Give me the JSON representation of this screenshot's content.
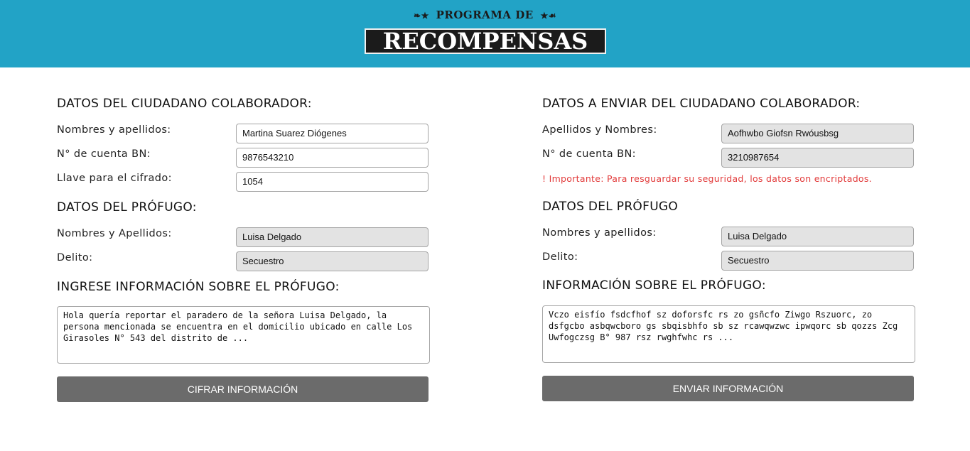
{
  "header": {
    "logo_top": "PROGRAMA DE",
    "logo_main": "RECOMPENSAS",
    "ornament_left": "❧★",
    "ornament_right": "★☙"
  },
  "left": {
    "collaborator_title": "DATOS DEL CIUDADANO COLABORADOR:",
    "name_label": "Nombres y apellidos:",
    "name_value": "Martina Suarez Diógenes",
    "account_label": "N° de cuenta BN:",
    "account_value": "9876543210",
    "key_label": "Llave para el cifrado:",
    "key_value": "1054",
    "fugitive_title": "DATOS DEL PRÓFUGO:",
    "fugitive_name_label": "Nombres y Apellidos:",
    "fugitive_name_value": "Luisa Delgado",
    "crime_label": "Delito:",
    "crime_value": "Secuestro",
    "info_title": "INGRESE INFORMACIÓN SOBRE EL PRÓFUGO:",
    "info_text": "Hola quería reportar el paradero de la señora Luisa Delgado, la persona mencionada se encuentra en el domicilio ubicado en calle Los Girasoles N° 543 del distrito de ...",
    "button_label": "CIFRAR INFORMACIÓN"
  },
  "right": {
    "collaborator_title": "DATOS A ENVIAR DEL CIUDADANO COLABORADOR:",
    "name_label": "Apellidos y Nombres:",
    "name_value": "Aofhwbo Giofsn Rwóusbsg",
    "account_label": "N° de cuenta BN:",
    "account_value": "3210987654",
    "warning": "! Importante: Para resguardar su seguridad, los datos son encriptados.",
    "fugitive_title": "DATOS DEL PRÓFUGO",
    "fugitive_name_label": "Nombres y apellidos:",
    "fugitive_name_value": "Luisa Delgado",
    "crime_label": "Delito:",
    "crime_value": "Secuestro",
    "info_title": "INFORMACIÓN SOBRE EL PRÓFUGO:",
    "info_text": "Vczo eisfío fsdcfhof sz doforsfc rs zo gsñcfo Ziwgo Rszuorc, zo dsfgcbo asbqwcboro gs sbqisbhfo sb sz rcawqwzwc ipwqorc sb qozzs Zcg Uwfogczsg B° 987 rsz rwghfwhc rs ...",
    "button_label": "ENVIAR INFORMACIÓN"
  },
  "colors": {
    "header_bg": "#22a3c6",
    "button_bg": "#6b6b6b",
    "warning": "#e23b3b",
    "disabled_bg": "#e3e3e3"
  }
}
